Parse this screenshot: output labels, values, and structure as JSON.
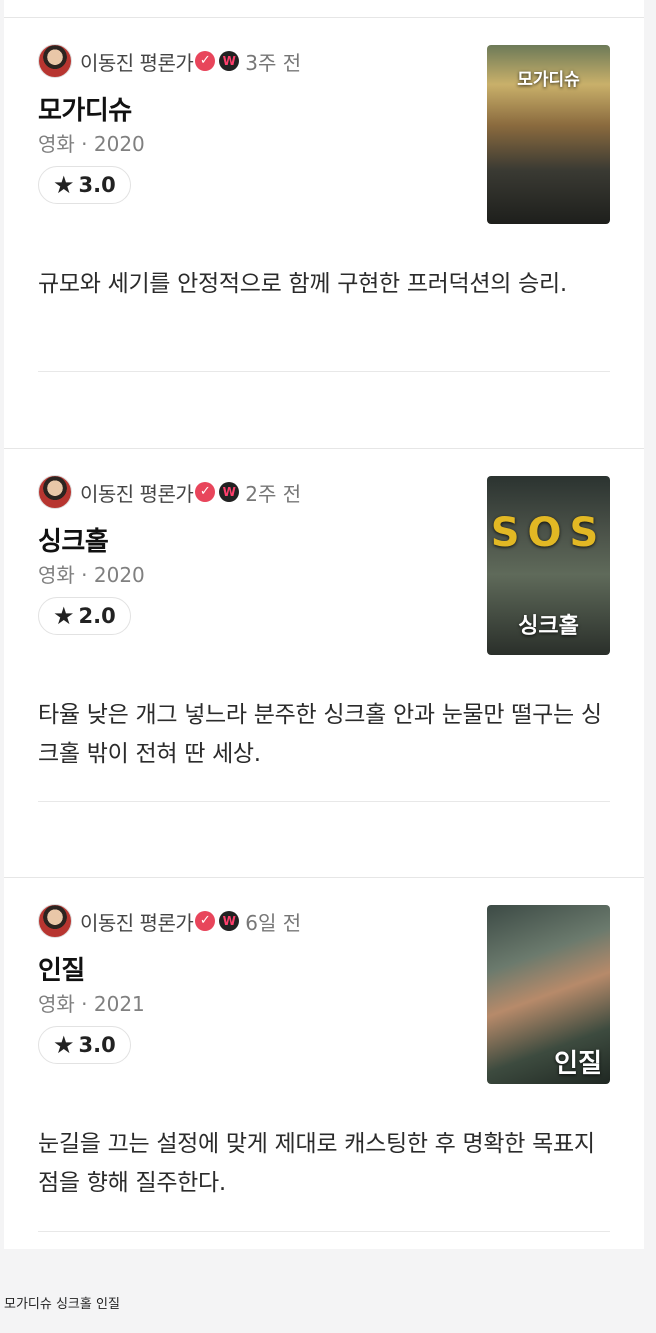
{
  "reviews": [
    {
      "author": "이동진 평론가",
      "verified_icon": "check-badge-icon",
      "watcha_icon": "watcha-badge-icon",
      "time": "3주 전",
      "title": "모가디슈",
      "meta": "영화 · 2020",
      "rating": "3.0",
      "poster_text": "모가디슈",
      "comment": "규모와 세기를 안정적으로 함께 구현한 프러덕션의 승리."
    },
    {
      "author": "이동진 평론가",
      "verified_icon": "check-badge-icon",
      "watcha_icon": "watcha-badge-icon",
      "time": "2주 전",
      "title": "싱크홀",
      "meta": "영화 · 2020",
      "rating": "2.0",
      "poster_text": "싱크홀",
      "comment": "타율 낮은 개그 넣느라 분주한 싱크홀 안과 눈물만 떨구는 싱크홀 밖이 전혀 딴 세상."
    },
    {
      "author": "이동진 평론가",
      "verified_icon": "check-badge-icon",
      "watcha_icon": "watcha-badge-icon",
      "time": "6일 전",
      "title": "인질",
      "meta": "영화 · 2021",
      "rating": "3.0",
      "poster_text": "인질",
      "comment": "눈길을 끄는 설정에 맞게 제대로 캐스팅한 후 명확한 목표지점을 향해 질주한다."
    }
  ],
  "caption": "모가디슈 싱크홀 인질"
}
